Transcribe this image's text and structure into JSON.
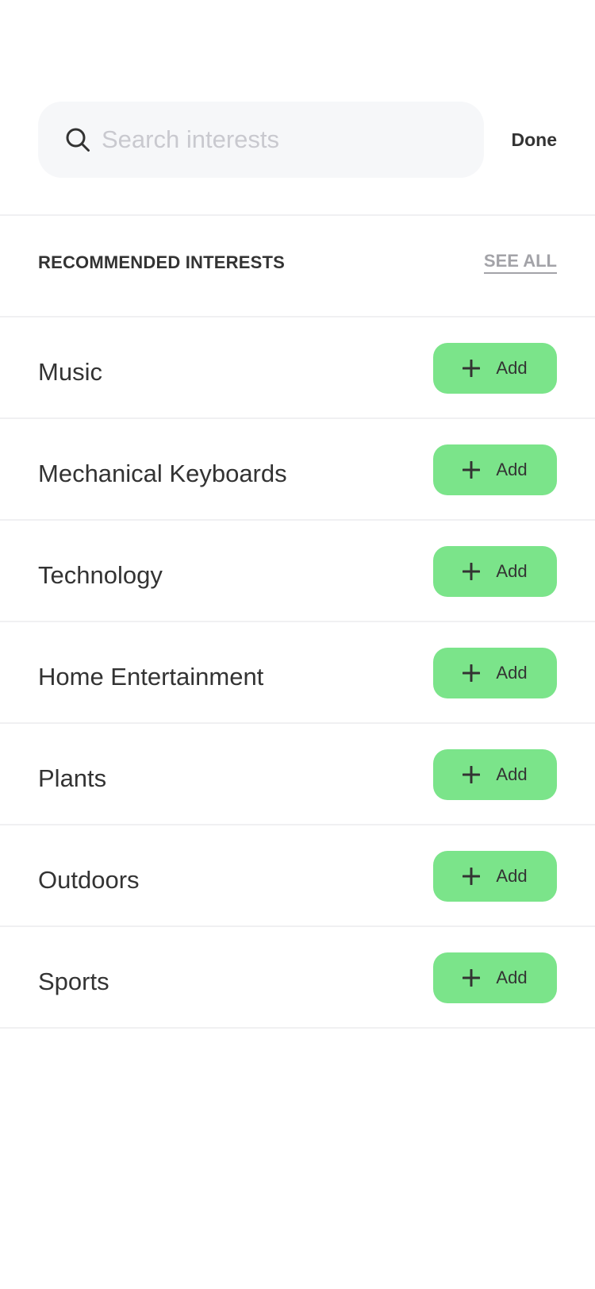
{
  "search": {
    "placeholder": "Search interests",
    "value": "",
    "icon": "search-icon"
  },
  "header": {
    "done_label": "Done"
  },
  "section": {
    "title": "RECOMMENDED INTERESTS",
    "see_all_label": "SEE ALL"
  },
  "interests": [
    {
      "label": "Music",
      "button_label": "Add",
      "icon": "plus-icon"
    },
    {
      "label": "Mechanical Keyboards",
      "button_label": "Add",
      "icon": "plus-icon"
    },
    {
      "label": "Technology",
      "button_label": "Add",
      "icon": "plus-icon"
    },
    {
      "label": "Home Entertainment",
      "button_label": "Add",
      "icon": "plus-icon"
    },
    {
      "label": "Plants",
      "button_label": "Add",
      "icon": "plus-icon"
    },
    {
      "label": "Outdoors",
      "button_label": "Add",
      "icon": "plus-icon"
    },
    {
      "label": "Sports",
      "button_label": "Add",
      "icon": "plus-icon"
    }
  ],
  "colors": {
    "accent_green": "#7be48a",
    "search_bg": "#f6f7f9",
    "text_primary": "#333333",
    "text_muted": "#a3a3a8",
    "placeholder": "#c9c9cf",
    "divider": "#f0f0f2"
  }
}
